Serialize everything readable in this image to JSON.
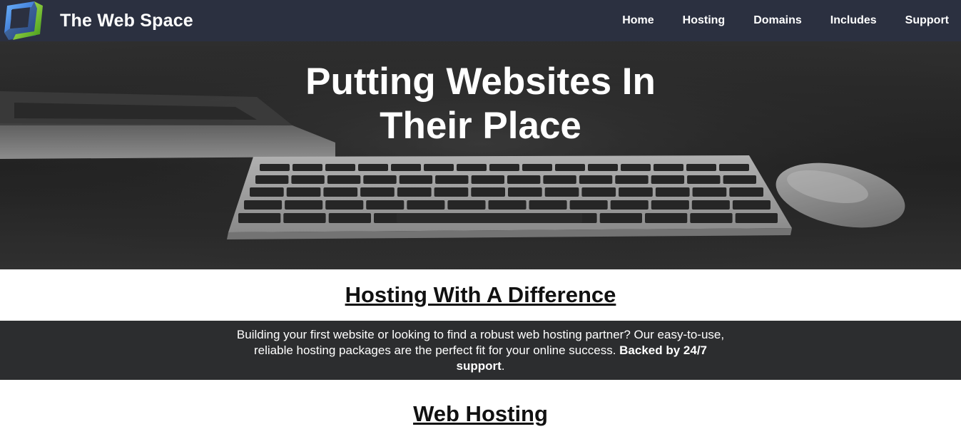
{
  "header": {
    "brand": "The Web Space",
    "logo_icon": "tilted-square-logo",
    "nav": [
      "Home",
      "Hosting",
      "Domains",
      "Includes",
      "Support"
    ]
  },
  "hero": {
    "title_line1": "Putting Websites In",
    "title_line2": "Their Place"
  },
  "intro": {
    "heading": "Hosting With A Difference",
    "text": "Building your first website or looking to find a robust web hosting partner? Our easy-to-use, reliable hosting packages are the perfect fit for your online success. ",
    "text_bold": "Backed by 24/7 support",
    "text_end": "."
  },
  "section2": {
    "heading": "Web Hosting"
  },
  "colors": {
    "nav_bg": "#2b3040",
    "band_bg": "#2c2d2f",
    "logo_blue": "#1f6fd0",
    "logo_green": "#7dc42a"
  }
}
